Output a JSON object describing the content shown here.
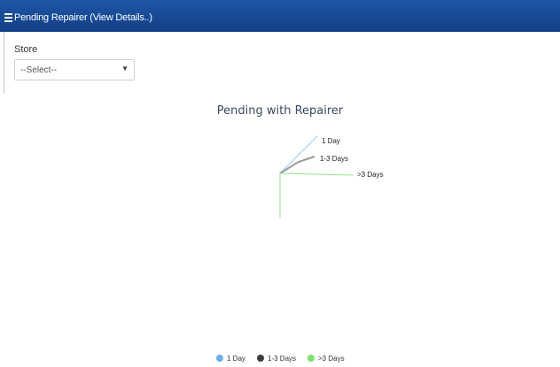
{
  "header": {
    "title": "Pending Repairer (View Details..)"
  },
  "filter": {
    "label": "Store",
    "select_value": "--Select--"
  },
  "colors": {
    "header": "#1a4b99",
    "one_day": "#99c9f2",
    "one_three": "#9a9a9a",
    "three_plus": "#94e887"
  },
  "chart_data": {
    "type": "pie",
    "title": "Pending with Repairer",
    "series": [
      {
        "name": "1 Day",
        "value": 0,
        "color": "#99c9f2",
        "legend_color": "#6aaee8"
      },
      {
        "name": "1-3 Days",
        "value": 0,
        "color": "#9a9a9a",
        "legend_color": "#3c3c3c"
      },
      {
        "name": ">3 Days",
        "value": 0,
        "color": "#94e887",
        "legend_color": "#7ee36b"
      }
    ],
    "legend_position": "bottom"
  }
}
